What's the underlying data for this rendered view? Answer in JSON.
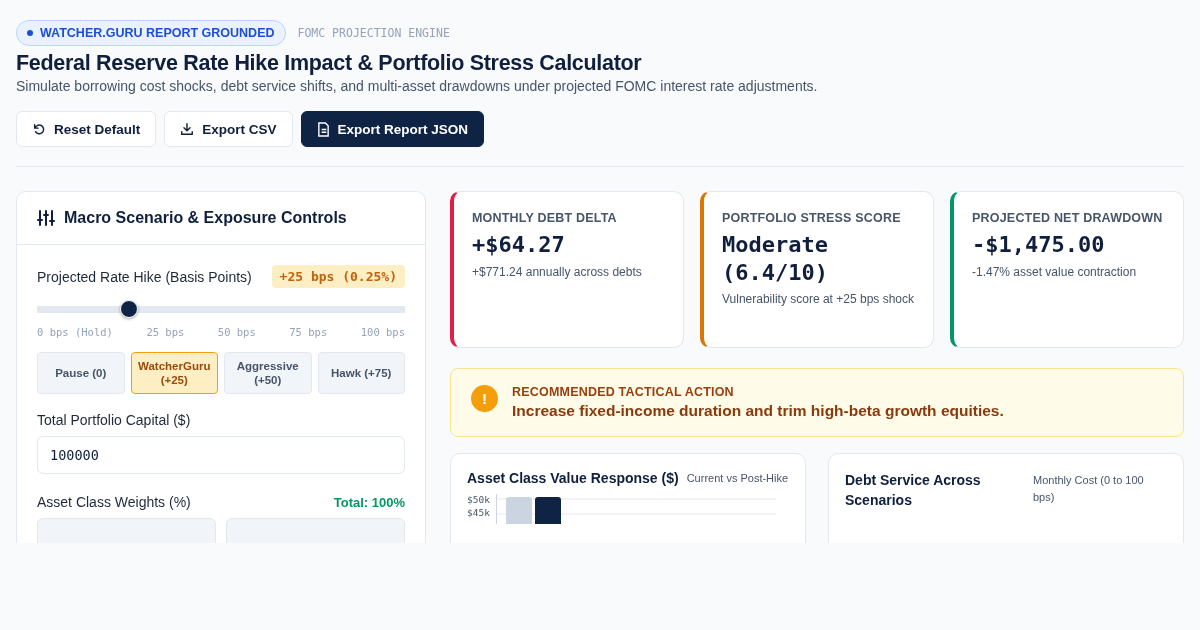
{
  "badge": "WATCHER.GURU REPORT GROUNDED",
  "eyebrow": "FOMC PROJECTION ENGINE",
  "title": "Federal Reserve Rate Hike Impact & Portfolio Stress Calculator",
  "subtitle": "Simulate borrowing cost shocks, debt service shifts, and multi-asset drawdowns under projected FOMC interest rate adjustments.",
  "actions": [
    {
      "label": "Reset Default",
      "kind": "reset"
    },
    {
      "label": "Export CSV",
      "kind": "download"
    },
    {
      "label": "Export Report JSON",
      "kind": "document"
    }
  ],
  "controls": {
    "title": "Macro Scenario & Exposure Controls",
    "rate": {
      "label": "Projected Rate Hike (Basis Points)",
      "reading": "+25 bps (0.25%)",
      "level": 0.25,
      "ticks": [
        "0 bps (Hold)",
        "25 bps",
        "50 bps",
        "75 bps",
        "100 bps"
      ]
    },
    "presets": [
      {
        "label": "Pause (0)",
        "selected": false
      },
      {
        "label": "WatcherGuru (+25)",
        "selected": true
      },
      {
        "label": "Aggressive (+50)",
        "selected": false
      },
      {
        "label": "Hawk (+75)",
        "selected": false
      }
    ],
    "capital": {
      "label": "Total Portfolio Capital ($)",
      "value": "100000"
    },
    "weights": {
      "label": "Asset Class Weights (%)",
      "total": "Total: 100%"
    }
  },
  "metrics": [
    {
      "label": "MONTHLY DEBT DELTA",
      "value": "+$64.27",
      "note": "+$771.24 annually across debts",
      "color": "#e11d48"
    },
    {
      "label": "PORTFOLIO STRESS SCORE",
      "value": "Moderate (6.4/10)",
      "note": "Vulnerability score at +25 bps shock",
      "color": "#d97706"
    },
    {
      "label": "PROJECTED NET DRAWDOWN",
      "value": "-$1,475.00",
      "note": "-1.47% asset value contraction",
      "color": "#059669"
    }
  ],
  "action": {
    "label": "RECOMMENDED TACTICAL ACTION",
    "text": "Increase fixed-income duration and trim high-beta growth equities.",
    "icon": "!"
  },
  "charts": [
    {
      "title": "Asset Class Value Response ($)",
      "subtitle": "Current vs Post-Hike",
      "ticks": [
        "$50k",
        "$45k"
      ]
    },
    {
      "title": "Debt Service Across Scenarios",
      "subtitle": "Monthly Cost (0 to 100 bps)"
    }
  ]
}
